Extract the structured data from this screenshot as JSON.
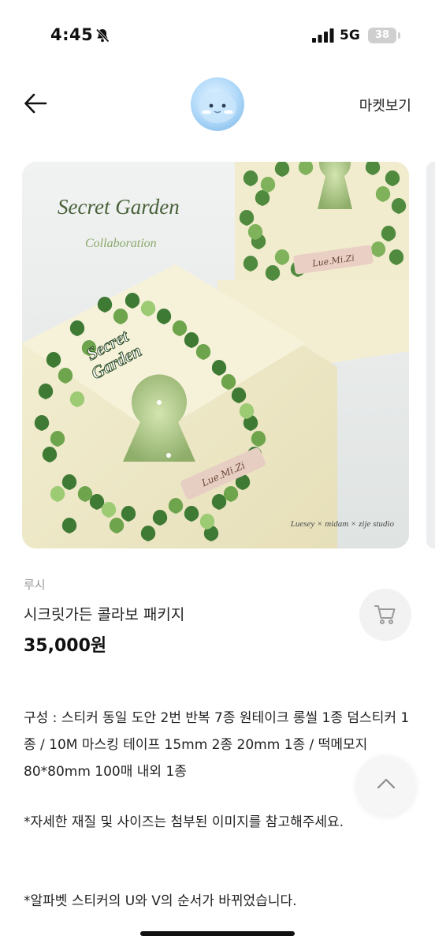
{
  "status_bar": {
    "time": "4:45",
    "network": "5G",
    "battery": "38"
  },
  "header": {
    "market_link": "마켓보기"
  },
  "product_image": {
    "headline": "Secret Garden",
    "subline": "Collaboration",
    "box_logo_top": "Secret",
    "box_logo_bottom": "Garden",
    "ribbon_text": "Lue.Mi.Zi",
    "credit": "Luesey × midam × zije studio"
  },
  "product": {
    "seller": "루시",
    "title": "시크릿가든 콜라보 패키지",
    "price": "35,000원"
  },
  "description": {
    "composition": "구성 : 스티커 동일 도안 2번 반복 7종 원테이크 롱씰 1종 덤스티커 1종 / 10M 마스킹 테이프 15mm 2종 20mm 1종 / 떡메모지 80*80mm 100매 내외 1종",
    "note_size": "*자세한 재질 및 사이즈는 첨부된 이미지를 참고해주세요.",
    "note_order": "*알파벳 스티커의 U와 V의 순서가 바뀌었습니다."
  },
  "colors": {
    "accent_green": "#5c8a3a",
    "ivy_dark": "#3f7a35",
    "box_cream": "#efe9c8"
  },
  "icons": {
    "back": "arrow-left-icon",
    "cart": "shopping-cart-icon",
    "scroll_top": "chevron-up-icon",
    "bell": "bell-slash-icon"
  }
}
